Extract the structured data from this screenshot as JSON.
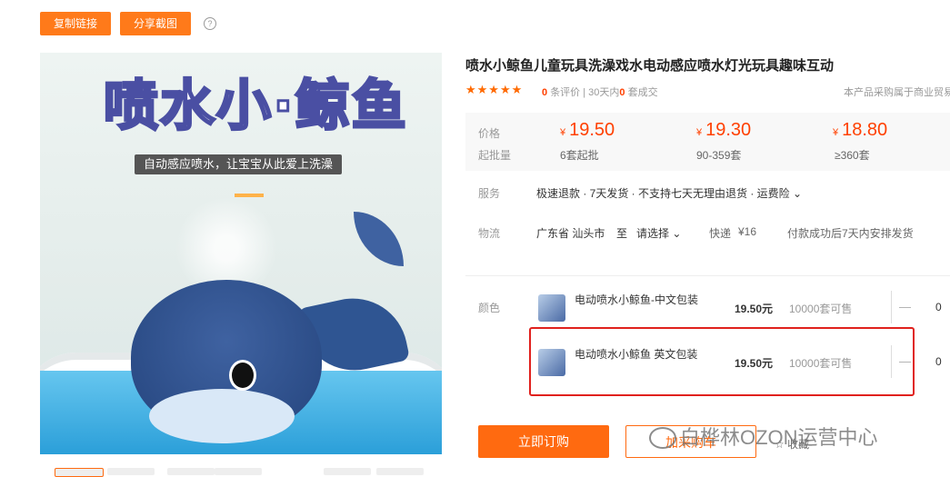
{
  "toolbar": {
    "copy_link_label": "复制链接",
    "share_image_label": "分享截图",
    "help_label": "?"
  },
  "hero": {
    "brand_text_a": "喷水小·",
    "brand_text_b": "鲸鱼",
    "subtitle": "自动感应喷水，让宝宝从此爱上洗澡"
  },
  "product": {
    "title": "喷水小鲸鱼儿童玩具洗澡戏水电动感应喷水灯光玩具趣味互动",
    "stars": "★★★★★",
    "rating_count": "0",
    "rating_text": "条评价",
    "sales_period": "30天内",
    "sales_count": "0",
    "sales_text": "套成交",
    "business_note": "本产品采购属于商业贸易"
  },
  "pricing": {
    "price_label": "价格",
    "moq_label": "起批量",
    "currency": "¥",
    "tiers": [
      {
        "price": "19.50",
        "qty": "6套起批"
      },
      {
        "price": "19.30",
        "qty": "90-359套"
      },
      {
        "price": "18.80",
        "qty": "≥360套"
      }
    ]
  },
  "service": {
    "label": "服务",
    "text": "极速退款 · 7天发货 · 不支持七天无理由退货 · 运费险 ⌄"
  },
  "logistics": {
    "label": "物流",
    "origin": "广东省 汕头市",
    "to": "至",
    "select": "请选择 ⌄",
    "method": "快递",
    "fee": "¥16",
    "note": "付款成功后7天内安排发货"
  },
  "color": {
    "label": "颜色",
    "skus": [
      {
        "name": "电动喷水小鲸鱼-中文包装",
        "price": "19.50元",
        "stock": "10000套可售",
        "qty": "0"
      },
      {
        "name": "电动喷水小鲸鱼 英文包装",
        "price": "19.50元",
        "stock": "10000套可售",
        "qty": "0"
      }
    ],
    "minus": "—"
  },
  "actions": {
    "buy_label": "立即订购",
    "cart_label": "加采购车",
    "fav_label": "☆ 收藏"
  },
  "watermark": {
    "text": "白桦林OZON运营中心"
  },
  "colors": {
    "accent": "#ff6a10",
    "price": "#ff4000",
    "highlight": "#e0211d"
  }
}
